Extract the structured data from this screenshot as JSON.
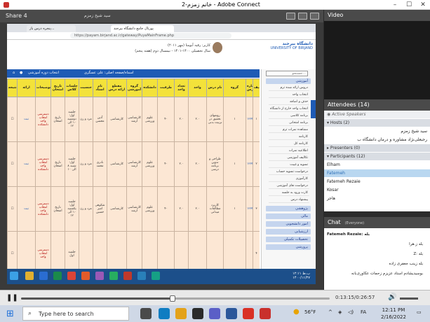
{
  "window": {
    "title": "خانم زمزم-2 - Adobe Connect"
  },
  "share_pod": {
    "title": "Share 4",
    "presenter_name": "سید شیخ زمزم"
  },
  "browser": {
    "tabs": [
      "پورتال جامع دانشگاه بیرجند",
      "پنجره درس باز..."
    ],
    "url": "https://payam.birjand.ac.ir/gateway/PuyaMainFrame.php"
  },
  "portal": {
    "university_fa": "دانشگاه بیرجند",
    "university_en": "UNIVERSITY OF BIRJAND",
    "student_line1": "کاربر: رقیه آبومنا (مهر ۲۰۱۱)",
    "student_line2": "سال تحصیلی ۱۴۰۰-۱۴۰۱ - نیمسال دوم (هفته پنجم)",
    "bluebar_left": "انتخاب دوره آموزشی",
    "bluebar_mid": "اسماه/صفحه اصلی: علی عسگری"
  },
  "table": {
    "headers": [
      "ردیف",
      "شماره درس",
      "گروه",
      "نام درس",
      "واحد",
      "تعداد واحد",
      "ظرفیت",
      "دانشکده",
      "گروه آموزشی",
      "مقطع ارائه درس",
      "نام استاد",
      "جنسیت",
      "جلسات کلاس",
      "تاریخ امتحان",
      "توضیحات",
      "ارائه",
      "نتیجه"
    ],
    "rows": [
      {
        "idx": "۱",
        "course": "روشهای تحقیق در تربیت بدنی",
        "units": "۲.۰",
        "cap": "۴۰",
        "faculty": "علوم ورزشی",
        "dept": "کارشناسی ارشد",
        "level": "کارشناسی",
        "teacher": "آذین محسن",
        "gender": "مرد و زن",
        "sessions": "جلسه اول: دوشنبه ۱۰ الی ۱۲",
        "exam": "تاریخ امتحان",
        "note": "دسترسی انتخاب واحد دانشکده",
        "code": "۱۲۳۴۵",
        "action": "ثبت"
      },
      {
        "idx": "۲",
        "course": "طراحی و تدوین برنامه درسی",
        "units": "۲.۰",
        "cap": "۴۰",
        "faculty": "علوم ورزشی",
        "dept": "کارشناسی ارشد",
        "level": "کارشناسی",
        "teacher": "نادری محمد",
        "gender": "مرد و زن",
        "sessions": "جلسه اول: شنبه ۸ الی ۱۰",
        "exam": "تاریخ امتحان",
        "note": "دسترسی انتخاب واحد دانشکده",
        "code": "۱۲۳۴۶",
        "action": "ثبت"
      },
      {
        "idx": "۳",
        "course": "کاربرد مطالعات میدانی",
        "units": "۲.۰",
        "cap": "۴۰",
        "faculty": "علوم ورزشی",
        "dept": "کارشناسی ارشد",
        "level": "کارشناسی",
        "teacher": "شکوهی امیر حسین",
        "gender": "مرد و زن",
        "sessions": "جلسه اول: یکشنبه ۱۰ الی ۱۲",
        "exam": "تاریخ امتحان",
        "note": "دسترسی انتخاب واحد دانشکده",
        "code": "۱۲۳۴۷",
        "action": "ثبت"
      },
      {
        "idx": "۴",
        "course": "",
        "units": "",
        "cap": "",
        "faculty": "",
        "dept": "",
        "level": "",
        "teacher": "",
        "gender": "",
        "sessions": "جلسه اول",
        "exam": "",
        "note": "دسترسی انتخاب واحد",
        "code": "",
        "action": ""
      }
    ]
  },
  "menu": {
    "search_placeholder": "جستجو...",
    "section_main": "آموزشی",
    "items": [
      "دروس ارائه شده ترم",
      "انتخاب واحد",
      "حذف و اضافه",
      "انتخاب واحد خارج از دانشگاه",
      "برنامه کلاسی",
      "برنامه امتحانی",
      "مشاهده نمرات ترم",
      "کارنامه",
      "کارنامه کل",
      "اطلاعیه نمرات",
      "تکالیف آموزشی",
      "تسویه و غیبت",
      "درخواست تسویه حساب",
      "کارآموزی",
      "درخواست های آموزشی",
      "کارت ورود به جلسه",
      "پیشنهاد درس"
    ],
    "sections_bottom": [
      "پژوهشی",
      "مالی",
      "امور دانشجویی",
      "ارزشیابی",
      "تحصیلات تکمیلی",
      "پرورشی"
    ]
  },
  "inner_clock": {
    "time": "۱۲:۱۱ ب.ظ",
    "date": "۱۴۰۰/۱۱/۲۷"
  },
  "video_pod": {
    "title": "Video"
  },
  "attendees": {
    "title": "Attendees",
    "count": "(14)",
    "active_speakers": "Active Speakers",
    "hosts_label": "Hosts (2)",
    "hosts": [
      "سید شیخ زمزم",
      "رجبعلی‌نژاد مشاوره و درمان دانشگاه ب"
    ],
    "presenters_label": "Presenters (0)",
    "participants_label": "Participants (12)",
    "participants": [
      "Elham",
      "Fatemeh",
      "Fatemeh Rezaie",
      "Kosar",
      "هاجر"
    ]
  },
  "chat": {
    "title": "Chat",
    "scope": "(Everyone)",
    "lines": [
      "Fatemeh Rezaie: بله",
      "بله ز.هرا",
      "Z: بله",
      "بله زینب جعفری زاده",
      "بوسیدیشادم استاد عزیزم زحمات عکاوری‌بانه"
    ]
  },
  "playback": {
    "time": "0:13:15/0:26:57",
    "progress": 0.49
  },
  "taskbar": {
    "search_placeholder": "Type here to search",
    "weather": "56°F",
    "lang": "FA",
    "time": "12:11 PM",
    "date": "2/16/2022"
  }
}
